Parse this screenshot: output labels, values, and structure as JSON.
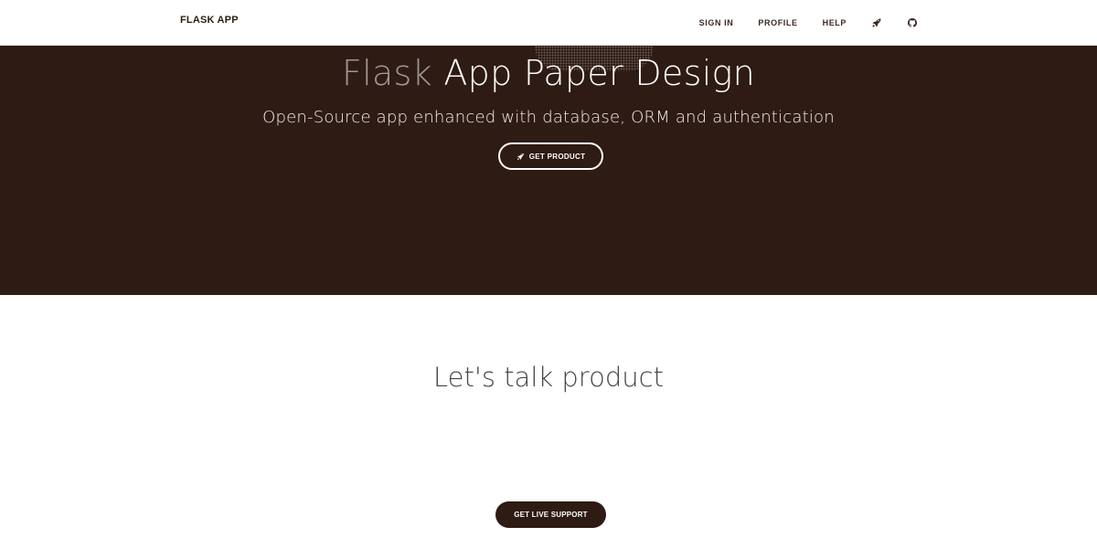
{
  "navbar": {
    "brand": "FLASK APP",
    "links": [
      {
        "label": "SIGN IN"
      },
      {
        "label": "PROFILE"
      },
      {
        "label": "HELP"
      }
    ],
    "icons": [
      "rocket-icon",
      "github-icon"
    ]
  },
  "hero": {
    "title_faded": "Flask",
    "title_main": " App Paper Design",
    "subtitle": "Open-Source app enhanced with database, ORM and authentication",
    "button_label": "GET PRODUCT",
    "button_icon": "rocket-icon"
  },
  "section": {
    "title": "Let's talk product",
    "button_label": "GET LIVE SUPPORT"
  },
  "colors": {
    "primary_dark": "#2e1b13",
    "white": "#ffffff",
    "text_muted": "#b8b2ae"
  }
}
